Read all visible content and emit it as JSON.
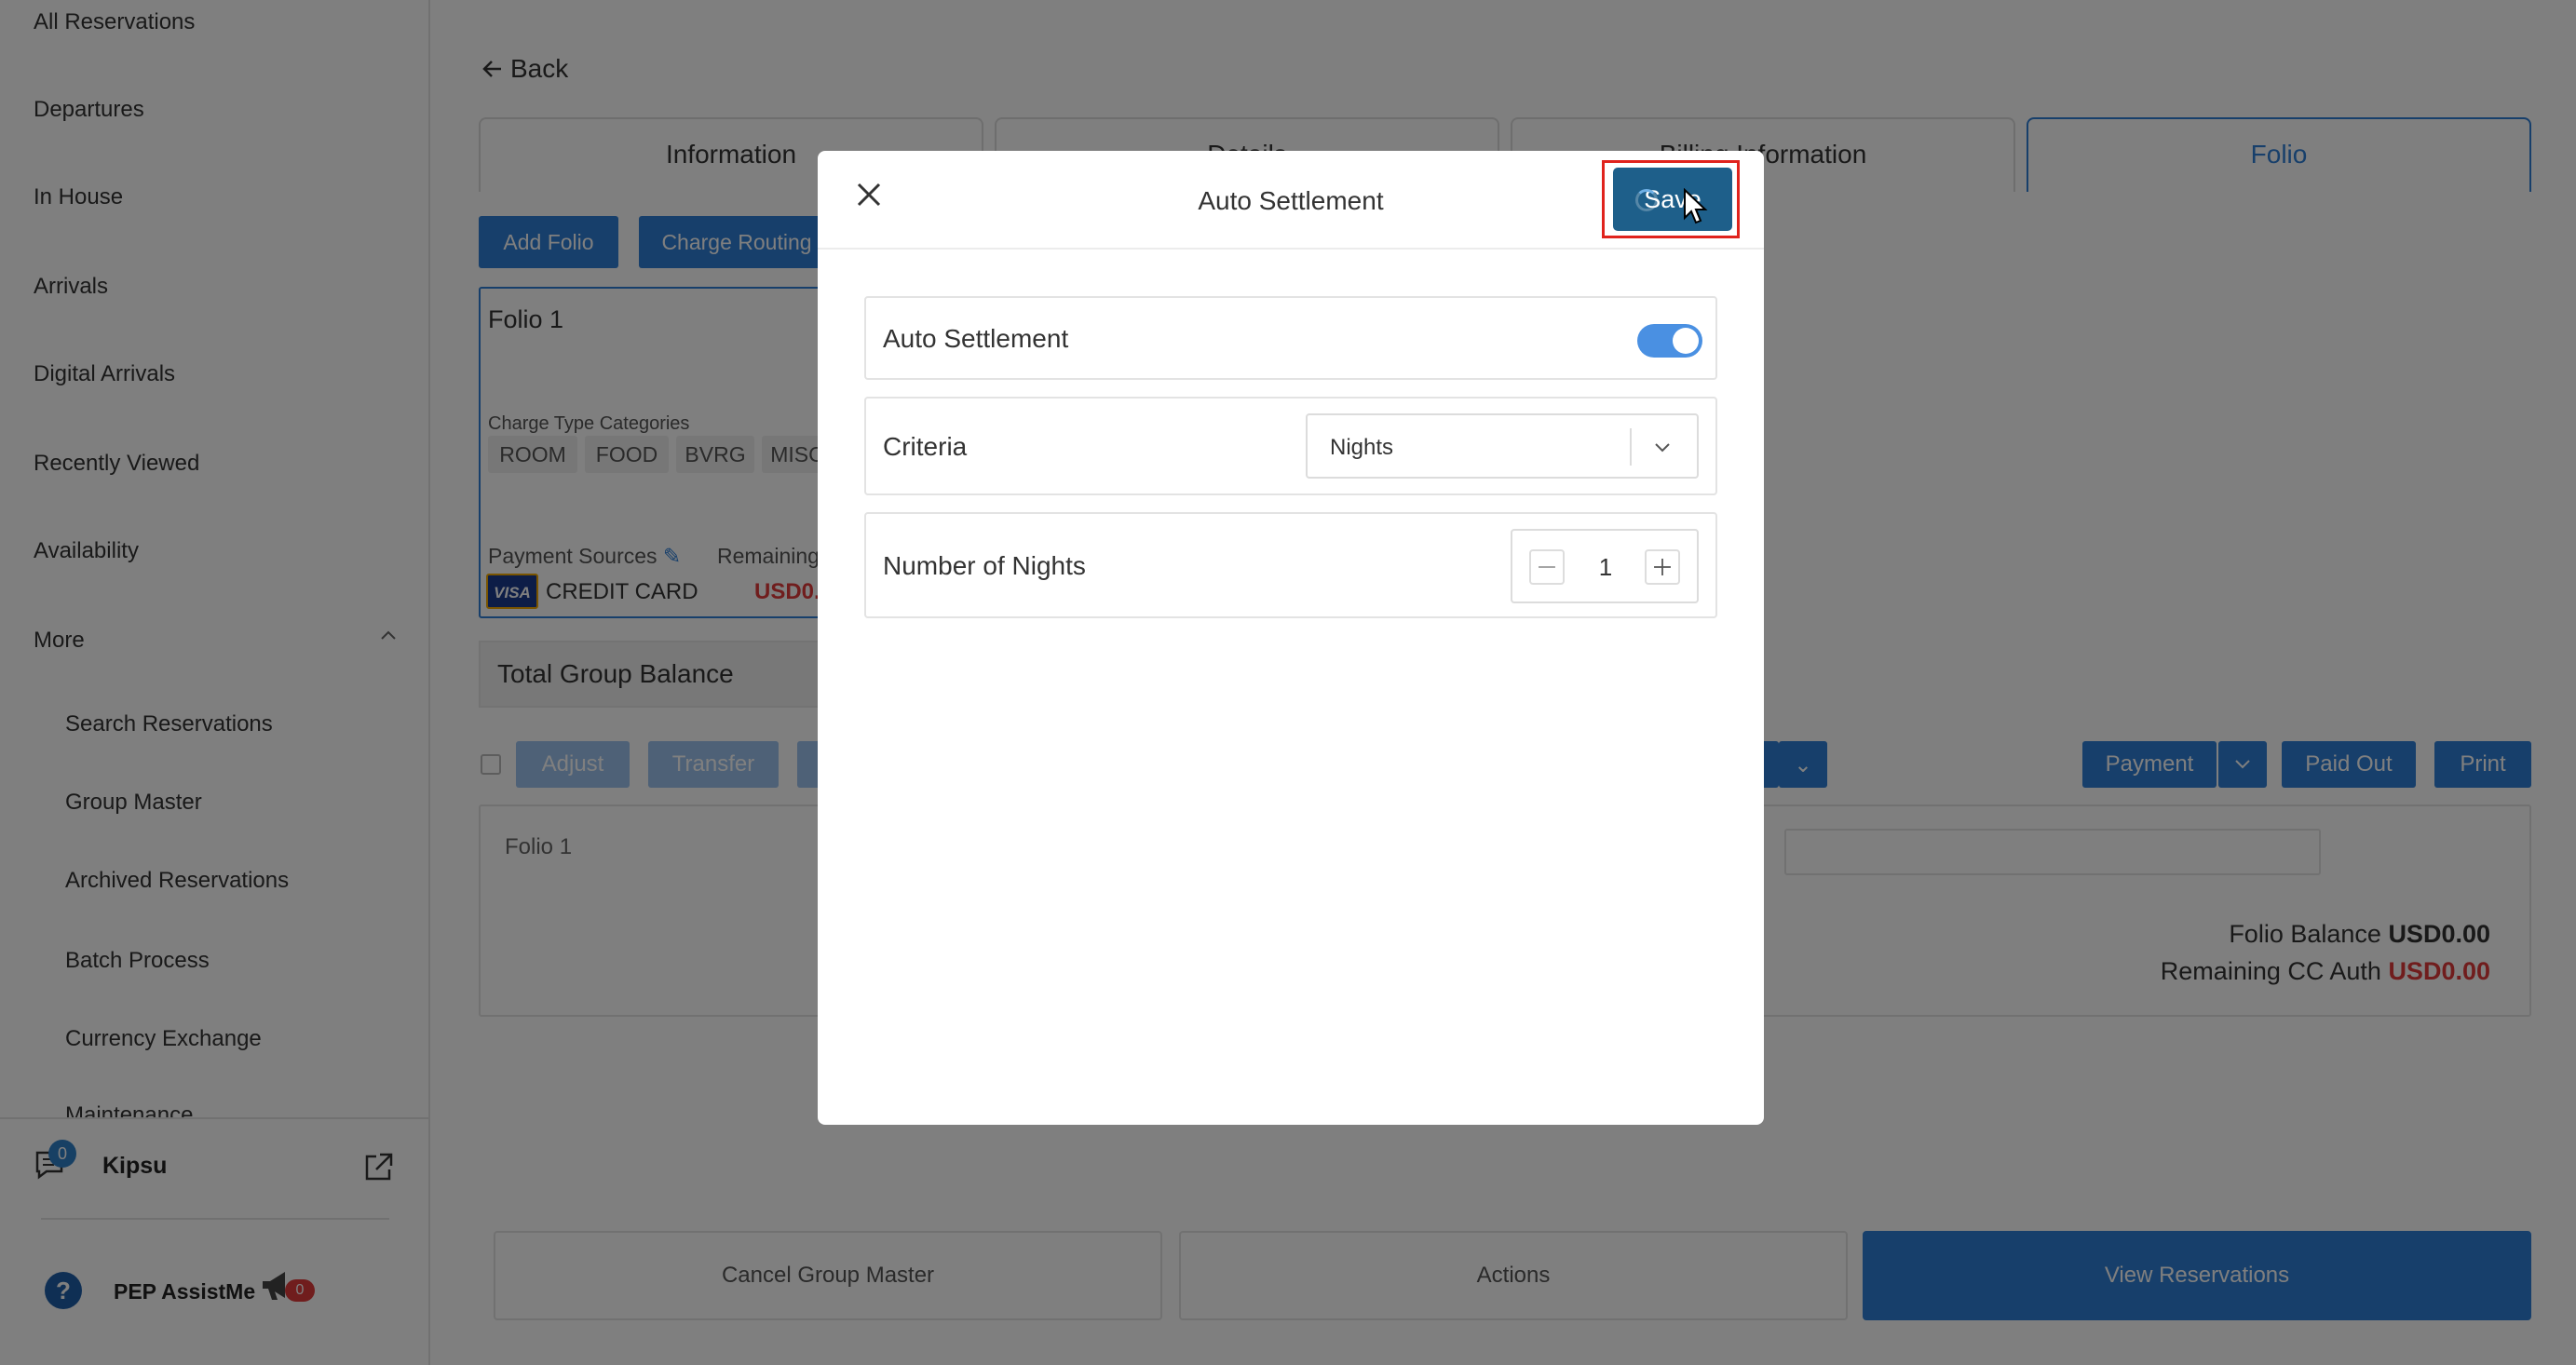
{
  "sidebar": {
    "items": [
      {
        "label": "All Reservations"
      },
      {
        "label": "Departures"
      },
      {
        "label": "In House"
      },
      {
        "label": "Arrivals"
      },
      {
        "label": "Digital Arrivals"
      },
      {
        "label": "Recently Viewed"
      },
      {
        "label": "Availability"
      },
      {
        "label": "More"
      }
    ],
    "sub_items": [
      {
        "label": "Search Reservations"
      },
      {
        "label": "Group Master"
      },
      {
        "label": "Archived Reservations"
      },
      {
        "label": "Batch Process"
      },
      {
        "label": "Currency Exchange"
      },
      {
        "label": "Maintenance"
      }
    ],
    "kipsu": {
      "label": "Kipsu",
      "badge": "0"
    },
    "pep": {
      "label": "PEP AssistMe",
      "badge": "0",
      "help": "?"
    }
  },
  "main": {
    "back_label": "Back",
    "tabs": [
      {
        "label": "Information"
      },
      {
        "label": "Details"
      },
      {
        "label": "Billing Information"
      },
      {
        "label": "Folio"
      }
    ],
    "buttons": {
      "add_folio": "Add Folio",
      "charge_routing": "Charge Routing"
    },
    "folio_card": {
      "title": "Folio 1",
      "charge_type_label": "Charge Type Categories",
      "chips": [
        "ROOM",
        "FOOD",
        "BVRG",
        "MISC"
      ],
      "payment_sources_label": "Payment Sources",
      "remaining_label": "Remaining",
      "card_brand": "VISA",
      "card_label": "CREDIT CARD",
      "remaining_value": "USD0."
    },
    "group_balance_label": "Total Group Balance",
    "actions": {
      "adjust": "Adjust",
      "transfer": "Transfer",
      "payment": "Payment",
      "paid_out": "Paid Out",
      "print": "Print"
    },
    "folio_panel": {
      "title": "Folio 1",
      "balance_label": "Folio Balance",
      "balance_value": "USD0.00",
      "remaining_auth_label": "Remaining CC Auth",
      "remaining_auth_value": "USD0.00"
    },
    "bottom": {
      "cancel": "Cancel Group Master",
      "actions": "Actions",
      "view": "View Reservations"
    }
  },
  "modal": {
    "title": "Auto Settlement",
    "save_label": "Save",
    "auto_settlement": {
      "label": "Auto Settlement",
      "enabled": true
    },
    "criteria": {
      "label": "Criteria",
      "value": "Nights"
    },
    "nights": {
      "label": "Number of Nights",
      "value": "1"
    }
  },
  "colors": {
    "primary": "#2f7fd6",
    "save": "#1e5f8a",
    "highlight": "#e0231d",
    "negative": "#e03b3b"
  }
}
